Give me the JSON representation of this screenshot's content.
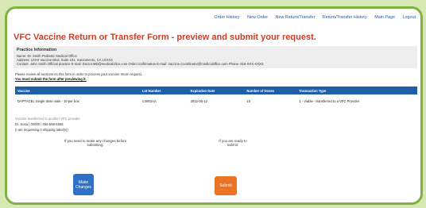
{
  "nav": [
    "Order History",
    "New Order",
    "New Return/Transfer",
    "Return/Transfer History",
    "Main Page",
    "Logout"
  ],
  "title": "VFC Vaccine Return or Transfer Form - preview and submit your request.",
  "practice": {
    "heading": "Practice Information",
    "name": "Name: Dr. Smith Pediatric Medical Office",
    "address": "Address: 1XXX Vaccine Blvd, Suite 101, Sacramento, CA 1XXXX",
    "contact": "Contact: John Smith   Official practice E-mail: Doctor.MD@medicalofice.com   Order confirmation E-mail: Vaccine.Coordinator@medicaloffice.com   Phone: 916-XXX-XXXX"
  },
  "instructions": "Please review all sections on this form in order to process your vaccine return request.",
  "submit_note": "You must submit the form after previewing it.",
  "table": {
    "headers": [
      "Vaccine",
      "Lot Number",
      "Expiration Date",
      "Number of Doses",
      "Transaction Type"
    ],
    "rows": [
      [
        "DAPTACEL Single dose vials - 10 per box",
        "C4802AA",
        "2012-06-12",
        "10",
        "1 - Viable - transferred to a VFC Provider"
      ]
    ]
  },
  "transfer": {
    "line1": "Vaccine transferred to another VFC provider",
    "line2": "Dr. Sosa | 00000 | 555-555-5555",
    "line3": "(I am requesting 0 shipping label(s))"
  },
  "changes_prompt": "If you need to make any changes before submitting:",
  "submit_prompt": "If you are ready to submit:",
  "buttons": {
    "make_changes": "Make Changes",
    "submit": "Submit"
  }
}
